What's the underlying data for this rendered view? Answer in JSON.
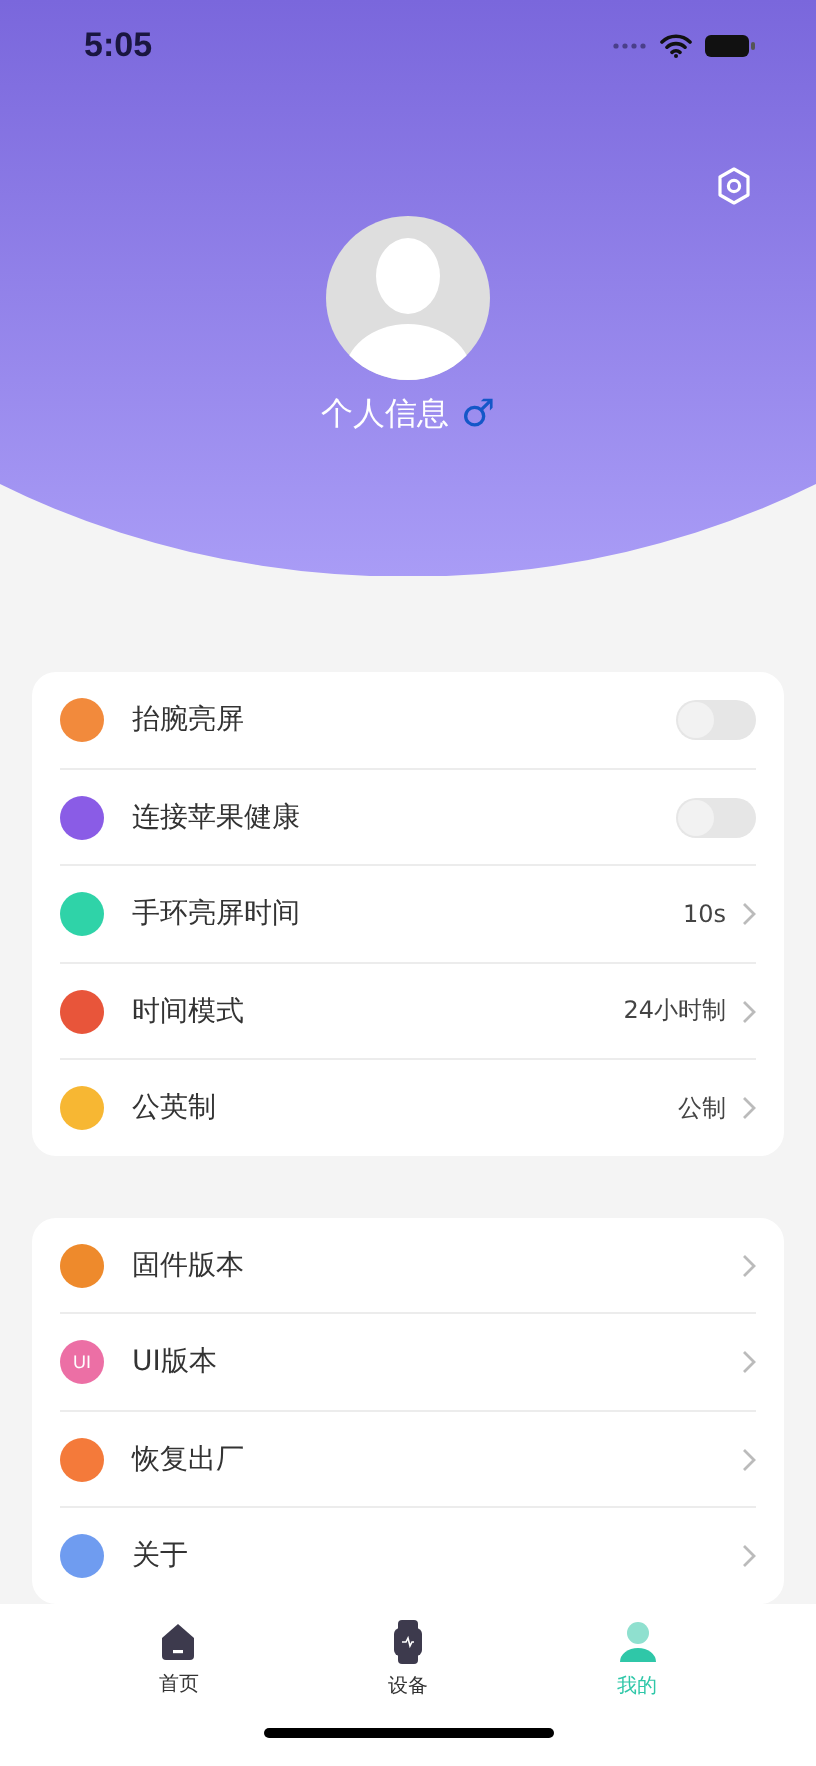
{
  "status_bar": {
    "time": "5:05"
  },
  "profile": {
    "name": "个人信息",
    "gender_symbol": "♂"
  },
  "settings_group": [
    {
      "kind": "toggle",
      "label": "抬腕亮屏",
      "on": false,
      "color": "#f28a3c"
    },
    {
      "kind": "toggle",
      "label": "连接苹果健康",
      "on": false,
      "color": "#8a5ce6"
    },
    {
      "kind": "value",
      "label": "手环亮屏时间",
      "value": "10s",
      "color": "#2fd3a8"
    },
    {
      "kind": "value",
      "label": "时间模式",
      "value": "24小时制",
      "color": "#e8553a"
    },
    {
      "kind": "value",
      "label": "公英制",
      "value": "公制",
      "color": "#f7b733"
    }
  ],
  "device_group": [
    {
      "kind": "link",
      "label": "固件版本",
      "color": "#ee8a2c"
    },
    {
      "kind": "link",
      "label": "UI版本",
      "color": "#ec6fa5",
      "icon_text": "UI"
    },
    {
      "kind": "link",
      "label": "恢复出厂",
      "color": "#f47a3a"
    },
    {
      "kind": "link",
      "label": "关于",
      "color": "#6f9cf0"
    }
  ],
  "tab_bar": [
    {
      "label": "首页",
      "selected": false
    },
    {
      "label": "设备",
      "selected": false
    },
    {
      "label": "我的",
      "selected": true
    }
  ]
}
